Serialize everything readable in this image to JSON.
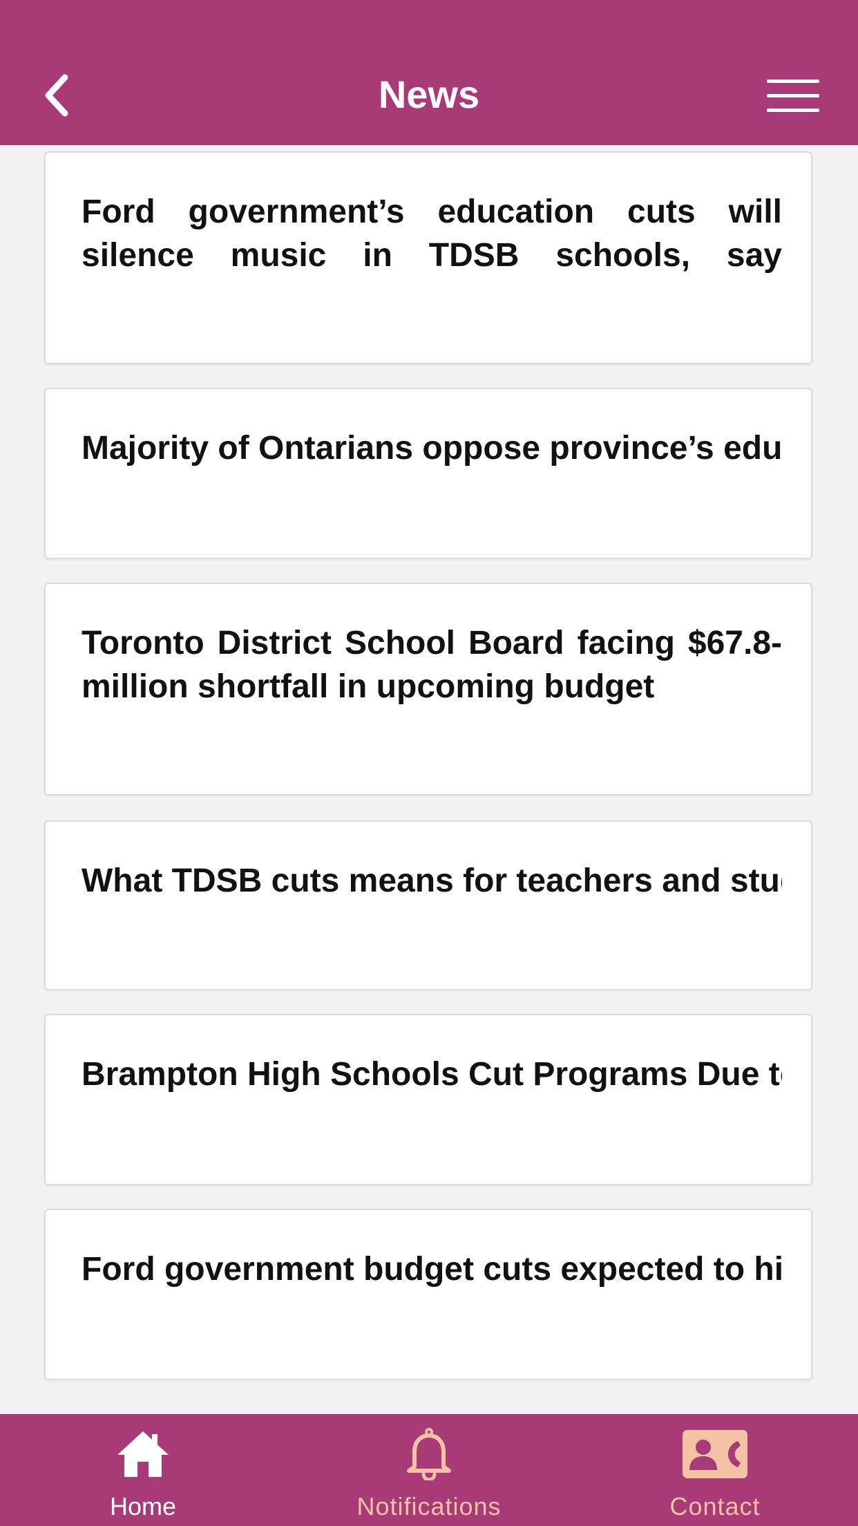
{
  "header": {
    "title": "News",
    "back_icon": "chevron-left-icon",
    "menu_icon": "hamburger-menu-icon"
  },
  "news": [
    {
      "title": "Ford government’s education cuts will silence music in TDSB schools, say instrumental music teachers"
    },
    {
      "title": "Majority of Ontarians oppose province’s education cuts"
    },
    {
      "title": "Toronto District School Board facing $67.8-million shortfall in upcoming budget"
    },
    {
      "title": "What TDSB cuts means for teachers and students"
    },
    {
      "title": "Brampton High Schools Cut Programs Due to Budget Cuts"
    },
    {
      "title": "Ford government budget cuts expected to hit schools"
    }
  ],
  "tabbar": {
    "tabs": [
      {
        "label": "Home",
        "icon": "home-icon",
        "active": true
      },
      {
        "label": "Notifications",
        "icon": "bell-icon",
        "active": false
      },
      {
        "label": "Contact",
        "icon": "contact-card-icon",
        "active": false
      }
    ]
  },
  "colors": {
    "brand": "#a83a78",
    "active_tab": "#ffffff",
    "inactive_tab": "#f6c2a5",
    "background": "#f2f2f2"
  }
}
